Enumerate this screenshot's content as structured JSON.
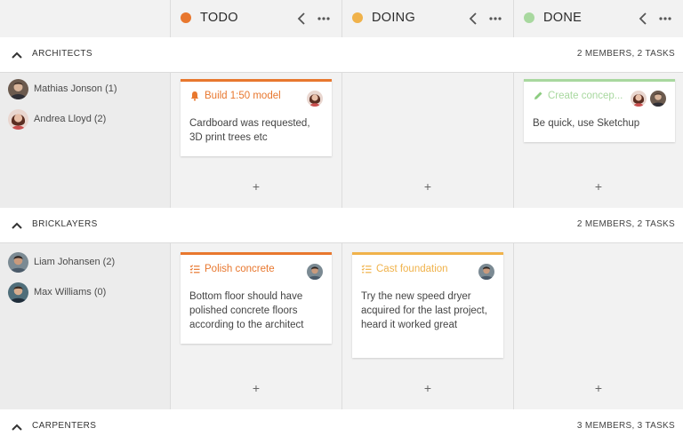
{
  "columns": [
    {
      "title": "TODO",
      "color": "#e8772e"
    },
    {
      "title": "DOING",
      "color": "#f0b24a"
    },
    {
      "title": "DONE",
      "color": "#a8d89f"
    }
  ],
  "groups": [
    {
      "name": "ARCHITECTS",
      "count": "2 MEMBERS, 2 TASKS",
      "members": [
        {
          "name": "Mathias Jonson (1)"
        },
        {
          "name": "Andrea Lloyd (2)"
        }
      ],
      "cards": {
        "todo": {
          "title": "Build 1:50 model",
          "body": "Cardboard was requested, 3D print trees etc",
          "icon": "bell-icon",
          "color": "#e8772e"
        },
        "done": {
          "title": "Create concep...",
          "body": "Be quick, use Sketchup",
          "icon": "pencil-icon",
          "color": "#a8d89f"
        }
      }
    },
    {
      "name": "BRICKLAYERS",
      "count": "2 MEMBERS, 2 TASKS",
      "members": [
        {
          "name": "Liam Johansen (2)"
        },
        {
          "name": "Max Williams (0)"
        }
      ],
      "cards": {
        "todo": {
          "title": "Polish concrete",
          "body": "Bottom floor should have polished concrete floors according to the architect",
          "icon": "checklist-icon",
          "color": "#e8772e"
        },
        "doing": {
          "title": "Cast foundation",
          "body": "Try the new speed dryer acquired for the last project, heard it worked great",
          "icon": "checklist-icon",
          "color": "#f0b24a"
        }
      }
    },
    {
      "name": "CARPENTERS",
      "count": "3 MEMBERS, 3 TASKS"
    }
  ],
  "add_label": "+"
}
